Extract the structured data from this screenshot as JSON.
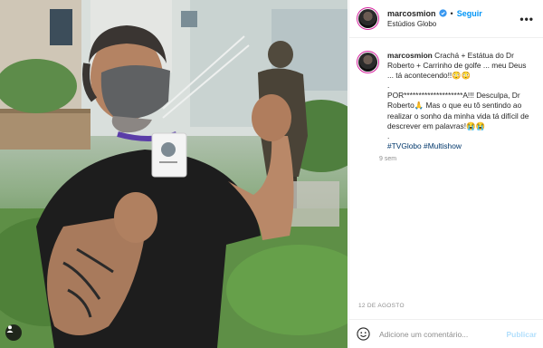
{
  "post": {
    "author": "marcosmion",
    "follow_label": "Seguir",
    "separator": "•",
    "location": "Estúdios Globo",
    "more_label": "•••",
    "caption_line1": "Crachá + Estátua do Dr Roberto + Carrinho de golfe ... meu Deus ... tá acontecendo!!😳😳",
    "caption_dot1": ".",
    "caption_line2": "POR********************A!!! Desculpa, Dr Roberto🙏 Mas o que eu tô sentindo ao realizar o sonho da minha vida tá difícil de descrever em palavras!😭😭",
    "caption_dot2": ".",
    "hashtags": "#TVGlobo #Multishow",
    "time_ago": "9 sem",
    "date": "12 DE AGOSTO"
  },
  "comment": {
    "placeholder": "Adicione um comentário...",
    "publish_label": "Publicar"
  },
  "colors": {
    "accent": "#0095f6",
    "verified": "#3897f0",
    "hashtag": "#00376b",
    "muted": "#8e8e8e"
  }
}
